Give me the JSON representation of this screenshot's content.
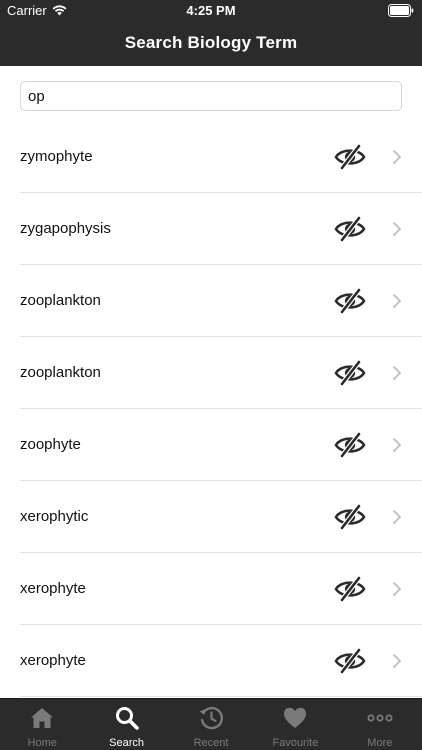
{
  "status_bar": {
    "carrier": "Carrier",
    "time": "4:25 PM"
  },
  "nav": {
    "title": "Search Biology Term"
  },
  "search": {
    "value": "op",
    "placeholder": ""
  },
  "results": [
    {
      "term": "zymophyte"
    },
    {
      "term": "zygapophysis"
    },
    {
      "term": "zooplankton"
    },
    {
      "term": "zooplankton"
    },
    {
      "term": "zoophyte"
    },
    {
      "term": "xerophytic"
    },
    {
      "term": "xerophyte"
    },
    {
      "term": "xerophyte"
    }
  ],
  "row_icons": {
    "visibility": "eye-slash-icon",
    "disclosure": "chevron-right-icon"
  },
  "tabs": [
    {
      "label": "Home",
      "icon": "home-icon",
      "active": false
    },
    {
      "label": "Search",
      "icon": "search-icon",
      "active": true
    },
    {
      "label": "Recent",
      "icon": "history-icon",
      "active": false
    },
    {
      "label": "Favourite",
      "icon": "heart-icon",
      "active": false
    },
    {
      "label": "More",
      "icon": "more-icon",
      "active": false
    }
  ],
  "colors": {
    "bar_background": "#2b2b2b",
    "tab_inactive": "#7a7a7a",
    "tab_active": "#ffffff",
    "separator": "#e3e3e3"
  }
}
